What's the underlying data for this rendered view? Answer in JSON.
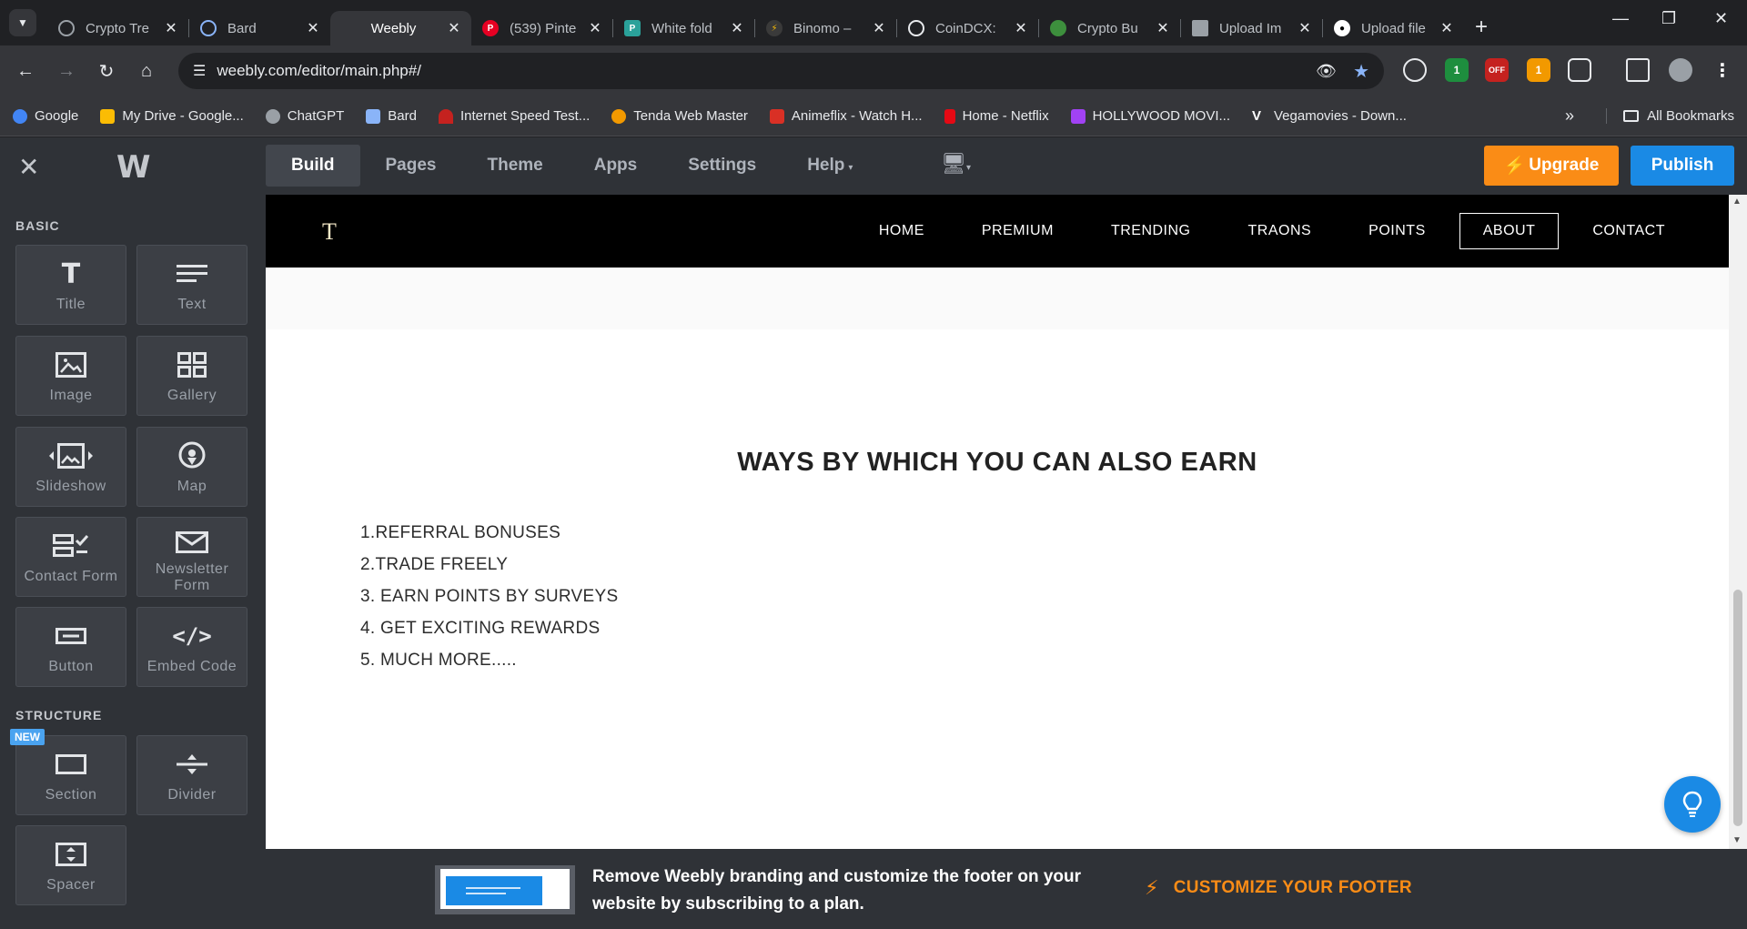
{
  "browser": {
    "tabs": [
      {
        "label": "Crypto Tre",
        "favicon_color": "#5f6368",
        "active": false
      },
      {
        "label": "Bard",
        "favicon_color": "#5f6368",
        "active": false
      },
      {
        "label": "Weebly",
        "favicon_color": "",
        "active": true
      },
      {
        "label": "(539) Pinte",
        "favicon_color": "#e60023",
        "active": false
      },
      {
        "label": "White fold",
        "favicon_color": "#2aa19a",
        "active": false
      },
      {
        "label": "Binomo – ",
        "favicon_color": "#3a3a3a",
        "active": false
      },
      {
        "label": "CoinDCX: ",
        "favicon_color": "#5f6368",
        "active": false
      },
      {
        "label": "Crypto Bu",
        "favicon_color": "#3d8f3d",
        "active": false
      },
      {
        "label": "Upload Im",
        "favicon_color": "#9aa0a6",
        "active": false
      },
      {
        "label": "Upload file",
        "favicon_color": "#ffffff",
        "active": false
      }
    ],
    "url": "weebly.com/editor/main.php#/",
    "bookmarks": [
      {
        "label": "Google",
        "color": "#4285f4"
      },
      {
        "label": "My Drive - Google...",
        "color": "#fbbc04"
      },
      {
        "label": "ChatGPT",
        "color": "#9aa0a6"
      },
      {
        "label": "Bard",
        "color": "#8ab4f8"
      },
      {
        "label": "Internet Speed Test...",
        "color": "#c5221f"
      },
      {
        "label": "Tenda Web Master",
        "color": "#f29900"
      },
      {
        "label": "Animeflix - Watch H...",
        "color": "#d93025"
      },
      {
        "label": "Home - Netflix",
        "color": "#e50914"
      },
      {
        "label": "HOLLYWOOD MOVI...",
        "color": "#a142f4"
      },
      {
        "label": "Vegamovies - Down...",
        "color": "#ffffff"
      }
    ],
    "all_bookmarks": "All Bookmarks",
    "extension_badges": [
      "1",
      "OFF",
      "1"
    ]
  },
  "editor": {
    "logo": "W",
    "tabs": [
      "Build",
      "Pages",
      "Theme",
      "Apps",
      "Settings",
      "Help"
    ],
    "active_tab": "Build",
    "upgrade_label": "Upgrade",
    "publish_label": "Publish",
    "sidebar": {
      "basic_heading": "BASIC",
      "basic": [
        "Title",
        "Text",
        "Image",
        "Gallery",
        "Slideshow",
        "Map",
        "Contact Form",
        "Newsletter Form",
        "Button",
        "Embed Code"
      ],
      "structure_heading": "STRUCTURE",
      "new_badge": "NEW",
      "structure": [
        "Section",
        "Divider",
        "Spacer"
      ]
    }
  },
  "site": {
    "logo": "T",
    "menu": [
      "HOME",
      "PREMIUM",
      "TRENDING",
      "TRAONS",
      "POINTS",
      "ABOUT",
      "CONTACT"
    ],
    "active_menu": "ABOUT",
    "heading": "WAYS BY WHICH YOU CAN ALSO EARN",
    "list": [
      "1.REFERRAL BONUSES",
      "2.TRADE FREELY",
      "3. EARN POINTS BY SURVEYS",
      "4. GET EXCITING REWARDS",
      "5. MUCH MORE....."
    ]
  },
  "footer_banner": {
    "text": "Remove Weebly branding and customize the footer on your website by subscribing to a plan.",
    "cta": "CUSTOMIZE YOUR FOOTER"
  },
  "colors": {
    "upgrade": "#fa8c16",
    "publish": "#1a8ae5",
    "editor_bg": "#2f3237"
  }
}
